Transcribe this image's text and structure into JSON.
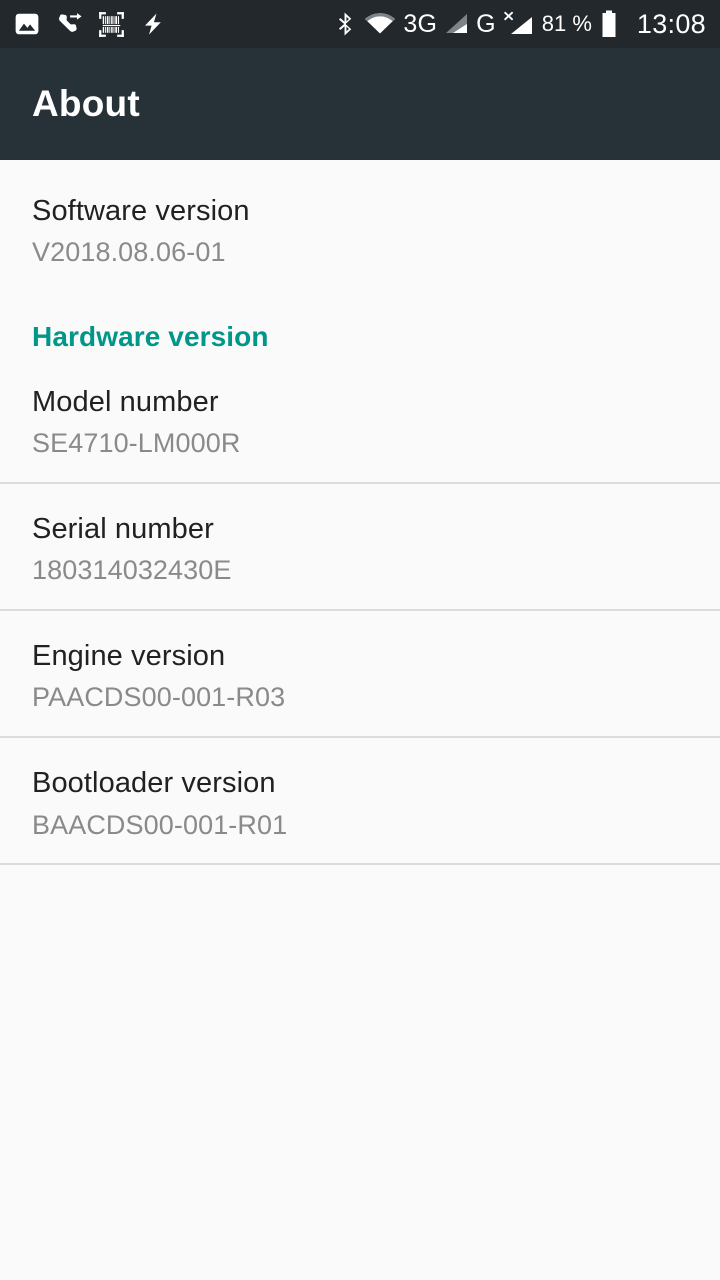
{
  "status_bar": {
    "left_icons": [
      {
        "name": "photo-icon",
        "label": "image"
      },
      {
        "name": "call-forward-icon",
        "label": "call forwarded"
      },
      {
        "name": "barcode-scanner-icon",
        "label": "barcode scanner"
      },
      {
        "name": "flash-icon",
        "label": "flash"
      }
    ],
    "right_icons": [
      {
        "name": "bluetooth-icon",
        "label": "bluetooth"
      },
      {
        "name": "wifi-icon",
        "label": "wifi"
      }
    ],
    "network_3g_label": "3G",
    "network_g_label": "G",
    "battery_percent": "81 %",
    "clock": "13:08"
  },
  "app_bar": {
    "title": "About"
  },
  "list": {
    "software_version": {
      "title": "Software version",
      "summary": "V2018.08.06-01"
    },
    "hardware_section_header": "Hardware version",
    "model_number": {
      "title": "Model number",
      "summary": "SE4710-LM000R"
    },
    "serial_number": {
      "title": "Serial number",
      "summary": "180314032430E"
    },
    "engine_version": {
      "title": "Engine version",
      "summary": "PAACDS00-001-R03"
    },
    "bootloader_version": {
      "title": "Bootloader version",
      "summary": "BAACDS00-001-R01"
    }
  },
  "colors": {
    "status_bar_bg": "#22282b",
    "app_bar_bg": "#263238",
    "page_bg": "#fafafa",
    "accent_teal": "#009688",
    "title_text": "#212121",
    "summary_text": "#8a8a8a",
    "divider": "#dcdcdc"
  }
}
